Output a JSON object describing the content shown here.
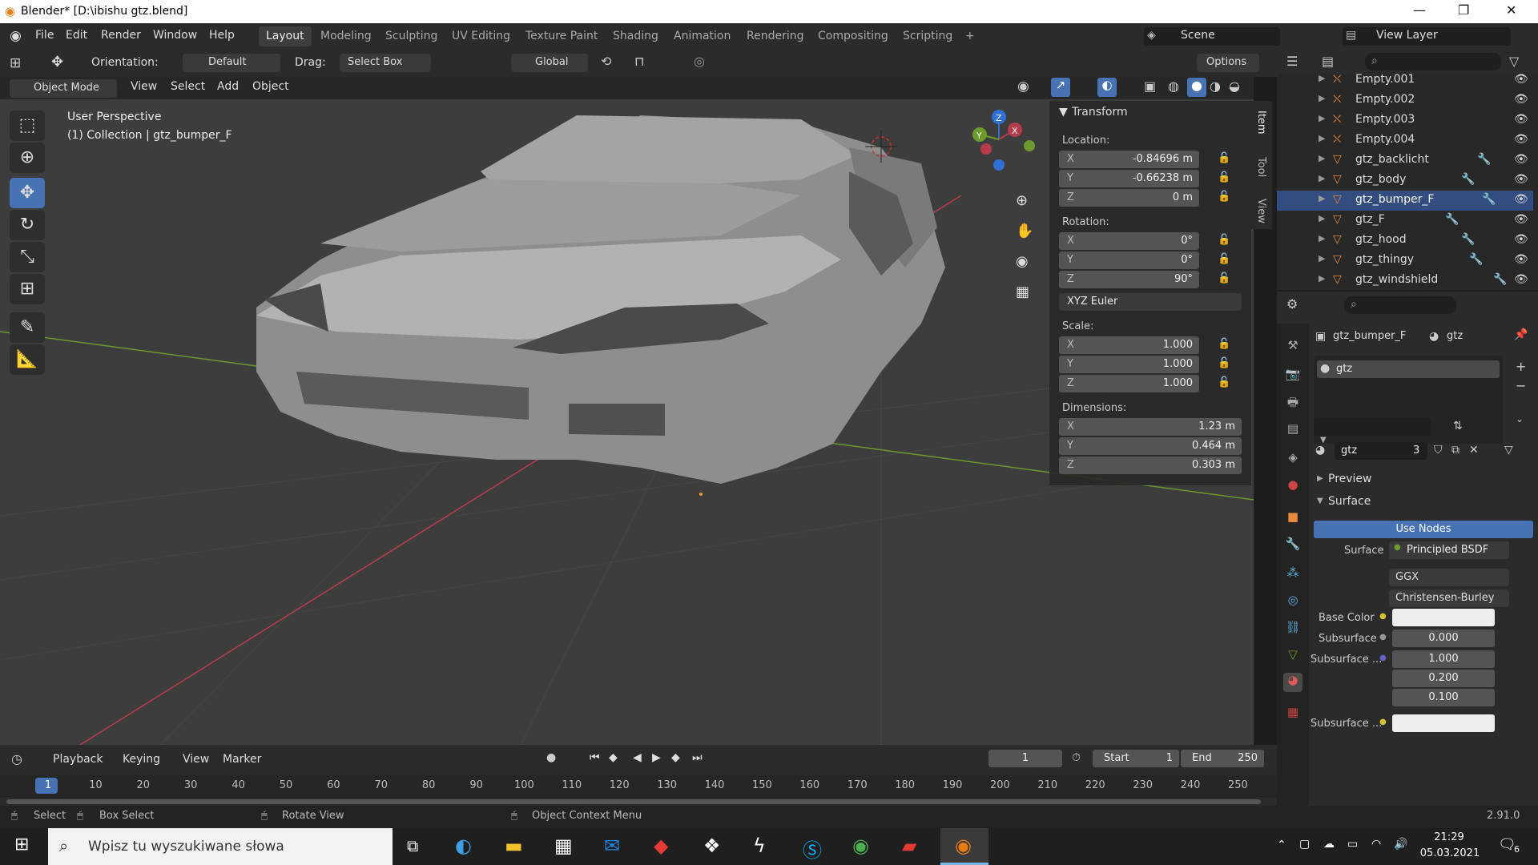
{
  "window": {
    "title": "Blender* [D:\\ibishu gtz.blend]",
    "minimize": "—",
    "maximize": "❐",
    "close": "✕"
  },
  "menu": [
    "File",
    "Edit",
    "Render",
    "Window",
    "Help"
  ],
  "workspaces": [
    "Layout",
    "Modeling",
    "Sculpting",
    "UV Editing",
    "Texture Paint",
    "Shading",
    "Animation",
    "Rendering",
    "Compositing",
    "Scripting"
  ],
  "workspace_add": "+",
  "scene": "Scene",
  "view_layer": "View Layer",
  "toolbar": {
    "orientation_label": "Orientation:",
    "orientation_value": "Default",
    "drag_label": "Drag:",
    "drag_value": "Select Box",
    "transform_orientation": "Global",
    "options": "Options"
  },
  "viewport_header": {
    "mode": "Object Mode",
    "menus": [
      "View",
      "Select",
      "Add",
      "Object"
    ]
  },
  "viewport": {
    "perspective": "User Perspective",
    "collection": "(1) Collection | gtz_bumper_F",
    "gizmo": {
      "x": "X",
      "y": "Y",
      "z": "Z"
    }
  },
  "n_panel": {
    "header": "Transform",
    "location_label": "Location:",
    "location": [
      {
        "axis": "X",
        "value": "-0.84696 m"
      },
      {
        "axis": "Y",
        "value": "-0.66238 m"
      },
      {
        "axis": "Z",
        "value": "0 m"
      }
    ],
    "rotation_label": "Rotation:",
    "rotation": [
      {
        "axis": "X",
        "value": "0°"
      },
      {
        "axis": "Y",
        "value": "0°"
      },
      {
        "axis": "Z",
        "value": "90°"
      }
    ],
    "rotation_mode": "XYZ Euler",
    "scale_label": "Scale:",
    "scale": [
      {
        "axis": "X",
        "value": "1.000"
      },
      {
        "axis": "Y",
        "value": "1.000"
      },
      {
        "axis": "Z",
        "value": "1.000"
      }
    ],
    "dimensions_label": "Dimensions:",
    "dimensions": [
      {
        "axis": "X",
        "value": "1.23 m"
      },
      {
        "axis": "Y",
        "value": "0.464 m"
      },
      {
        "axis": "Z",
        "value": "0.303 m"
      }
    ],
    "tabs": [
      "Item",
      "Tool",
      "View"
    ]
  },
  "outliner": {
    "items": [
      {
        "name": "Empty.001",
        "type": "empty"
      },
      {
        "name": "Empty.002",
        "type": "empty"
      },
      {
        "name": "Empty.003",
        "type": "empty"
      },
      {
        "name": "Empty.004",
        "type": "empty"
      },
      {
        "name": "gtz_backlicht",
        "type": "mesh"
      },
      {
        "name": "gtz_body",
        "type": "mesh"
      },
      {
        "name": "gtz_bumper_F",
        "type": "mesh"
      },
      {
        "name": "gtz_F",
        "type": "mesh"
      },
      {
        "name": "gtz_hood",
        "type": "mesh"
      },
      {
        "name": "gtz_thingy",
        "type": "mesh"
      },
      {
        "name": "gtz_windshield",
        "type": "mesh"
      }
    ]
  },
  "properties": {
    "object_name": "gtz_bumper_F",
    "material_name": "gtz",
    "slot": "gtz",
    "material_field": "gtz",
    "users": "3",
    "preview": "Preview",
    "surface_section": "Surface",
    "use_nodes": "Use Nodes",
    "surface_label": "Surface",
    "surface_value": "Principled BSDF",
    "distribution": "GGX",
    "subsurface_method": "Christensen-Burley",
    "base_color_label": "Base Color",
    "subsurface_label": "Subsurface",
    "subsurface_value": "0.000",
    "subsurface_radius_label": "Subsurface ...",
    "subsurface_radius": [
      "1.000",
      "0.200",
      "0.100"
    ],
    "subsurface_color_label": "Subsurface ..."
  },
  "timeline": {
    "menus": [
      "Playback",
      "Keying",
      "View",
      "Marker"
    ],
    "current_frame": "1",
    "start_label": "Start",
    "start": "1",
    "end_label": "End",
    "end": "250",
    "ruler": [
      "1",
      "10",
      "20",
      "30",
      "40",
      "50",
      "60",
      "70",
      "80",
      "90",
      "100",
      "110",
      "120",
      "130",
      "140",
      "150",
      "160",
      "170",
      "180",
      "190",
      "200",
      "210",
      "220",
      "230",
      "240",
      "250"
    ]
  },
  "statusbar": {
    "select": "Select",
    "box_select": "Box Select",
    "rotate_view": "Rotate View",
    "context_menu": "Object Context Menu",
    "version": "2.91.0"
  },
  "taskbar": {
    "search_placeholder": "Wpisz tu wyszukiwane słowa",
    "time": "21:29",
    "date": "05.03.2021",
    "notifications": "6"
  },
  "colors": {
    "accent": "#4772b3",
    "selected_row": "#334d80",
    "x_axis": "#b73c4a",
    "y_axis": "#6c9a2c",
    "z_axis": "#2f6fd6"
  }
}
